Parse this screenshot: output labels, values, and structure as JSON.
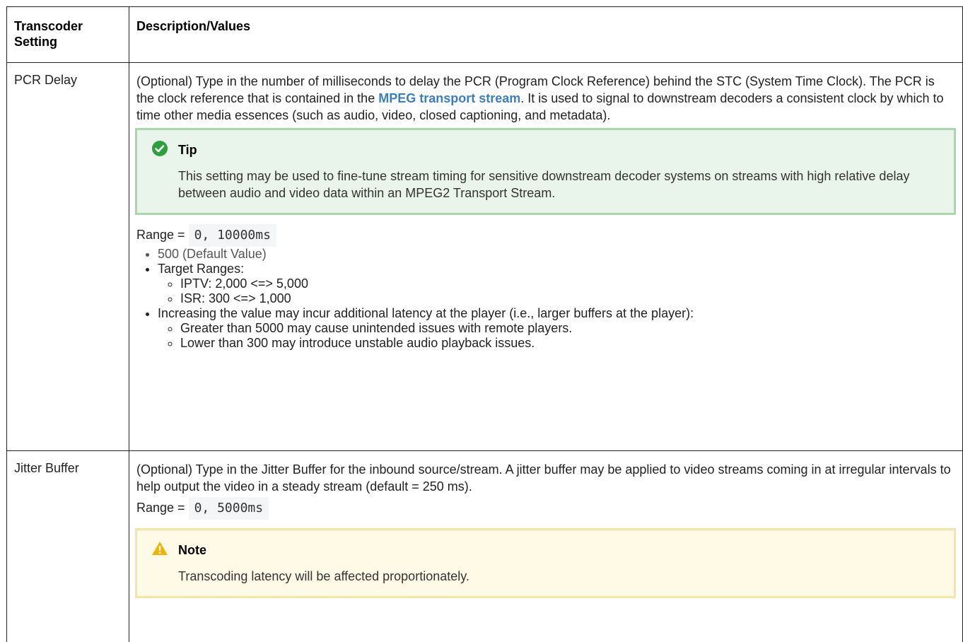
{
  "table": {
    "headers": {
      "setting": "Transcoder Setting",
      "description": "Description/Values"
    },
    "pcr": {
      "name": "PCR Delay",
      "desc_start": "(Optional) Type in the number of milliseconds to delay the PCR (Program Clock Reference) behind the STC (System Time Clock). The PCR is the clock reference that is contained in the ",
      "link": "MPEG transport stream",
      "desc_end": ". It is used to signal to downstream decoders a consistent clock by which to time other media essences (such as audio, video, closed captioning, and metadata).",
      "tip": {
        "title": "Tip",
        "body": "This setting may be used to fine-tune stream timing for sensitive downstream decoder systems on streams with high relative delay between audio and video data within an MPEG2 Transport Stream."
      },
      "range_label": "Range =",
      "range_value": "0, 10000ms",
      "default_value": "500 (Default Value)",
      "target_ranges": "Target Ranges:",
      "iptv": "IPTV: 2,000 <=> 5,000",
      "isr": "ISR: 300 <=> 1,000",
      "increase": "Increasing the value may incur additional latency at the player (i.e., larger buffers at the player):",
      "greater": "Greater than 5000 may cause unintended issues with remote players.",
      "lower": "Lower than 300 may introduce unstable audio playback issues."
    },
    "jitter": {
      "name": "Jitter Buffer",
      "desc": "(Optional) Type in the Jitter Buffer for the inbound source/stream. A jitter buffer may be applied to video streams coming in at irregular intervals to help output the video in a steady stream (default = 250 ms).",
      "range_label": "Range =",
      "range_value": "0, 5000ms",
      "note": {
        "title": "Note",
        "body": "Transcoding latency will be affected proportionately."
      }
    }
  },
  "colors": {
    "tip_icon": "#2e9e3e",
    "note_icon": "#f0b400",
    "link": "#3a7fc0"
  },
  "icons": {
    "tip": "check-circle-icon",
    "note": "warning-icon"
  }
}
